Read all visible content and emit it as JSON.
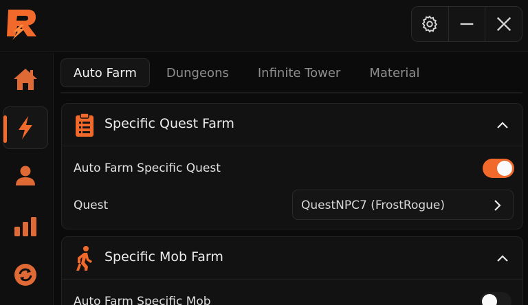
{
  "colors": {
    "accent": "#f26a2b",
    "background": "#0b0b0b",
    "panel": "#121212"
  },
  "header": {
    "logo_icon": "r-lightning-logo-icon",
    "controls": [
      {
        "name": "settings",
        "icon": "gear-icon"
      },
      {
        "name": "minimize",
        "icon": "minus-icon"
      },
      {
        "name": "close",
        "icon": "close-icon"
      }
    ]
  },
  "sidebar": {
    "items": [
      {
        "icon": "home-icon",
        "active": false
      },
      {
        "icon": "lightning-icon",
        "active": true
      },
      {
        "icon": "user-icon",
        "active": false
      },
      {
        "icon": "bar-chart-icon",
        "active": false
      },
      {
        "icon": "refresh-icon",
        "active": false
      }
    ]
  },
  "tabs": [
    {
      "label": "Auto Farm",
      "active": true
    },
    {
      "label": "Dungeons",
      "active": false
    },
    {
      "label": "Infinite Tower",
      "active": false
    },
    {
      "label": "Material",
      "active": false
    }
  ],
  "sections": {
    "quest": {
      "title": "Specific Quest Farm",
      "icon": "clipboard-icon",
      "toggle_label": "Auto Farm Specific Quest",
      "toggle_on": true,
      "quest_label": "Quest",
      "quest_value": "QuestNPC7 (FrostRogue)"
    },
    "mob": {
      "title": "Specific Mob Farm",
      "icon": "walking-person-icon",
      "toggle_label": "Auto Farm Specific Mob",
      "toggle_on": false
    }
  }
}
